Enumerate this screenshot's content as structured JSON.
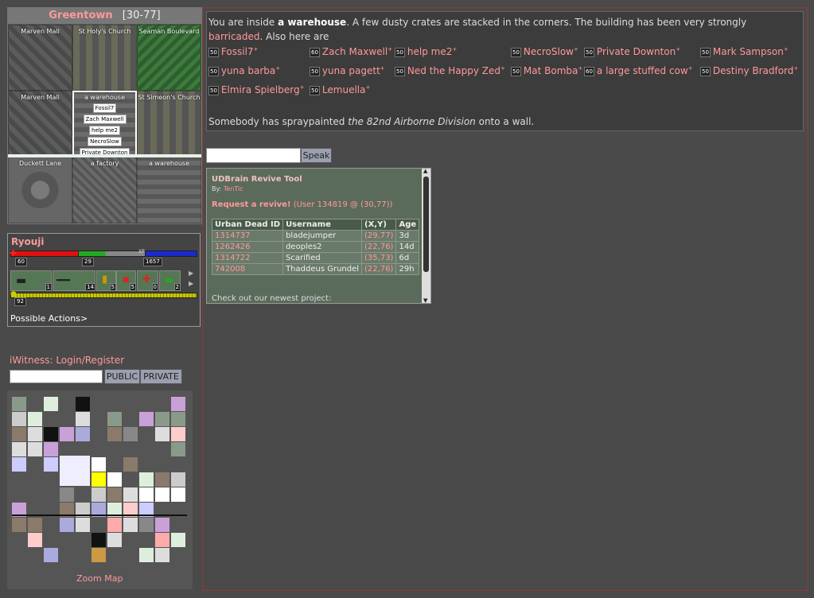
{
  "town": {
    "name": "Greentown",
    "coords": "[30-77]",
    "cells": [
      {
        "label": "Marven Mall",
        "style": "mall",
        "tags": []
      },
      {
        "label": "St Holy's Church",
        "style": "church",
        "tags": []
      },
      {
        "label": "Seaman Boulevard",
        "style": "street",
        "tags": []
      },
      {
        "label": "Marven Mall",
        "style": "mall",
        "tags": []
      },
      {
        "label": "a warehouse",
        "style": "wh",
        "tags": [
          "Fossil7",
          "Zach Maxwell",
          "help me2",
          "NecroSlow",
          "Private Downton",
          "..."
        ]
      },
      {
        "label": "St Simeon's Church",
        "style": "church",
        "tags": []
      },
      {
        "label": "Duckett Lane",
        "style": "square",
        "tags": []
      },
      {
        "label": "a factory",
        "style": "factory",
        "tags": []
      },
      {
        "label": "a warehouse",
        "style": "wh",
        "tags": []
      }
    ]
  },
  "character": {
    "name": "Ryouji",
    "hp": "60",
    "hp_fraction": 0.5,
    "ap": "29",
    "xp": "1657",
    "inventory_counts": [
      "1",
      "14",
      "5",
      "5",
      "0",
      "2"
    ],
    "encumbrance": "92",
    "actions": "Possible Actions>"
  },
  "iwitness": {
    "prefix": "iWitness: ",
    "login": "Login",
    "sep": "/",
    "register": "Register",
    "public": "PUBLIC",
    "private": "PRIVATE"
  },
  "zoom_map": "Zoom Map",
  "description": {
    "p1": "You are inside ",
    "place": "a warehouse",
    "p2": ". A few dusty crates are stacked in the corners. The building has been very strongly ",
    "barricaded": "barricaded",
    "p3": ". Also here are",
    "graffiti_pre": "Somebody has spraypainted ",
    "graffiti": "the 82nd Airborne Division",
    "graffiti_post": " onto a wall."
  },
  "people": [
    {
      "lvl": "50",
      "name": "Fossil7",
      "plus": "+"
    },
    {
      "lvl": "60",
      "name": "Zach Maxwell",
      "plus": "+"
    },
    {
      "lvl": "50",
      "name": "help me2",
      "plus": "+"
    },
    {
      "lvl": "50",
      "name": "NecroSlow",
      "plus": "+"
    },
    {
      "lvl": "50",
      "name": "Private Downton",
      "plus": "+"
    },
    {
      "lvl": "50",
      "name": "Mark Sampson",
      "plus": "+"
    },
    {
      "lvl": "50",
      "name": "yuna barba",
      "plus": "+"
    },
    {
      "lvl": "50",
      "name": "yuna pagett",
      "plus": "+"
    },
    {
      "lvl": "50",
      "name": "Ned the Happy Zed",
      "plus": "+"
    },
    {
      "lvl": "50",
      "name": "Mat Bomba",
      "plus": "+"
    },
    {
      "lvl": "60",
      "name": "a large stuffed cow",
      "plus": "+"
    },
    {
      "lvl": "50",
      "name": "Destiny Bradford",
      "plus": "+"
    },
    {
      "lvl": "50",
      "name": "Elmira Spielberg",
      "plus": "+"
    },
    {
      "lvl": "50",
      "name": "Lemuella",
      "plus": "+"
    }
  ],
  "speak": {
    "button": "Speak"
  },
  "revive": {
    "title": "UDBrain Revive Tool",
    "by_prefix": "By: ",
    "by": "TenTic",
    "request": "Request a revive!",
    "request_info": " (User 134819 @ (30,77))",
    "headers": [
      "Urban Dead ID",
      "Username",
      "(X,Y)",
      "Age"
    ],
    "rows": [
      [
        "1314737",
        "bladejumper",
        "(29,77)",
        "3d"
      ],
      [
        "1262426",
        "deoples2",
        "(22,76)",
        "14d"
      ],
      [
        "1314722",
        "Scarified",
        "(35,73)",
        "6d"
      ],
      [
        "742008",
        "Thaddeus Grundel",
        "(22,76)",
        "29h"
      ]
    ],
    "newest": "Check out our newest project:"
  }
}
